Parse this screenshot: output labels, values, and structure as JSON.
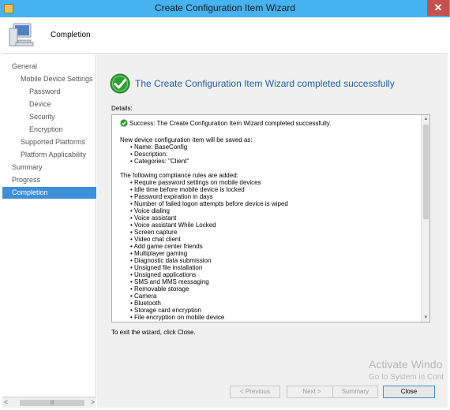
{
  "window": {
    "title": "Create Configuration Item Wizard",
    "close_glyph": "✕"
  },
  "header": {
    "title": "Completion"
  },
  "nav": {
    "items": [
      {
        "label": "General",
        "indent": 0,
        "active": false
      },
      {
        "label": "Mobile Device Settings",
        "indent": 1,
        "active": false
      },
      {
        "label": "Password",
        "indent": 2,
        "active": false
      },
      {
        "label": "Device",
        "indent": 2,
        "active": false
      },
      {
        "label": "Security",
        "indent": 2,
        "active": false
      },
      {
        "label": "Encryption",
        "indent": 2,
        "active": false
      },
      {
        "label": "Supported Platforms",
        "indent": 1,
        "active": false
      },
      {
        "label": "Platform Applicability",
        "indent": 1,
        "active": false
      },
      {
        "label": "Summary",
        "indent": 0,
        "active": false
      },
      {
        "label": "Progress",
        "indent": 0,
        "active": false
      },
      {
        "label": "Completion",
        "indent": 0,
        "active": true
      }
    ],
    "scroll_left": "<",
    "scroll_right": ">",
    "scroll_thumb": "|||"
  },
  "main": {
    "title": "The Create Configuration Item Wizard completed successfully",
    "details_label": "Details:",
    "success_line": "Success: The Create Configuration Item Wizard completed successfully.",
    "saved_intro": "New device configuration item will be saved as:",
    "saved_items": [
      "Name: BaseConfig",
      "Description:",
      "Categories: \"Client\""
    ],
    "rules_intro": "The following compliance rules are added:",
    "rules": [
      "Require password settings on mobile devices",
      "Idle time before mobile device is locked",
      "Password expiration in days",
      "Number of failed logon attempts before device is wiped",
      "Voice dialing",
      "Voice assistant",
      "Voice assistant While Locked",
      "Screen capture",
      "Video chat client",
      "Add game center friends",
      "Multiplayer gaming",
      "Diagnostic data submission",
      "Unsigned file installation",
      "Unsigned applications",
      "SMS and MMS messaging",
      "Removable storage",
      "Camera",
      "Bluetooth",
      "Storage card encryption",
      "File encryption on mobile device"
    ],
    "exit_text": "To exit the wizard, click Close.",
    "watermark_line1": "Activate Windo",
    "watermark_line2": "Go to System in Cont",
    "scroll_up": "▲",
    "scroll_down": "▼"
  },
  "buttons": {
    "previous": "< Previous",
    "next": "Next >",
    "summary": "Summary",
    "close": "Close"
  },
  "colors": {
    "titlebar": "#45b3f0",
    "accent": "#3c8fd8",
    "title_text": "#1f5fa8",
    "success_green": "#2f9e32"
  }
}
